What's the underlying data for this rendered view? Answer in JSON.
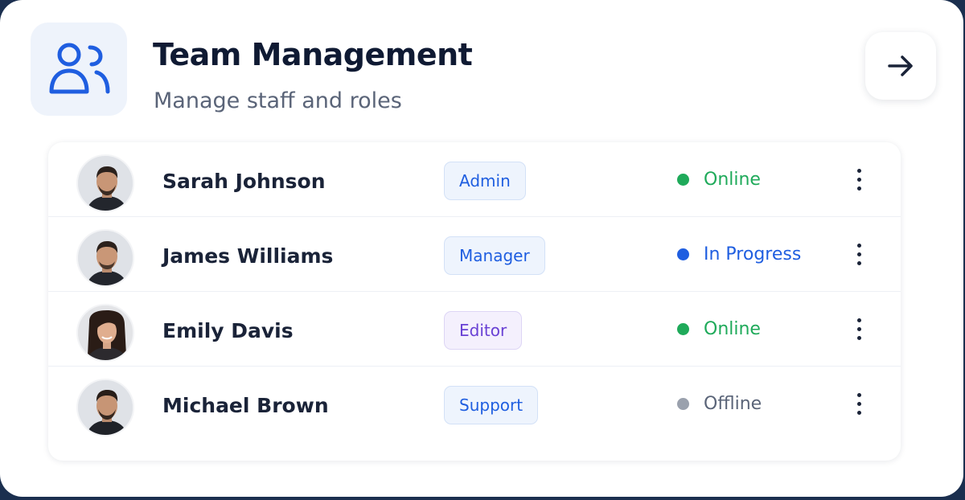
{
  "header": {
    "title": "Team Management",
    "subtitle": "Manage staff and roles",
    "icon": "users-icon",
    "nav_icon": "arrow-right-icon",
    "accent_color": "#1f5ee0"
  },
  "members": [
    {
      "name": "Sarah Johnson",
      "role": "Admin",
      "status": "Online",
      "status_color": "#1faa5a",
      "avatar": "male"
    },
    {
      "name": "James Williams",
      "role": "Manager",
      "status": "In Progress",
      "status_color": "#1f5ee0",
      "avatar": "male"
    },
    {
      "name": "Emily Davis",
      "role": "Editor",
      "status": "Online",
      "status_color": "#1faa5a",
      "avatar": "female"
    },
    {
      "name": "Michael Brown",
      "role": "Support",
      "status": "Offline",
      "status_color": "#9aa1ad",
      "avatar": "male"
    }
  ]
}
